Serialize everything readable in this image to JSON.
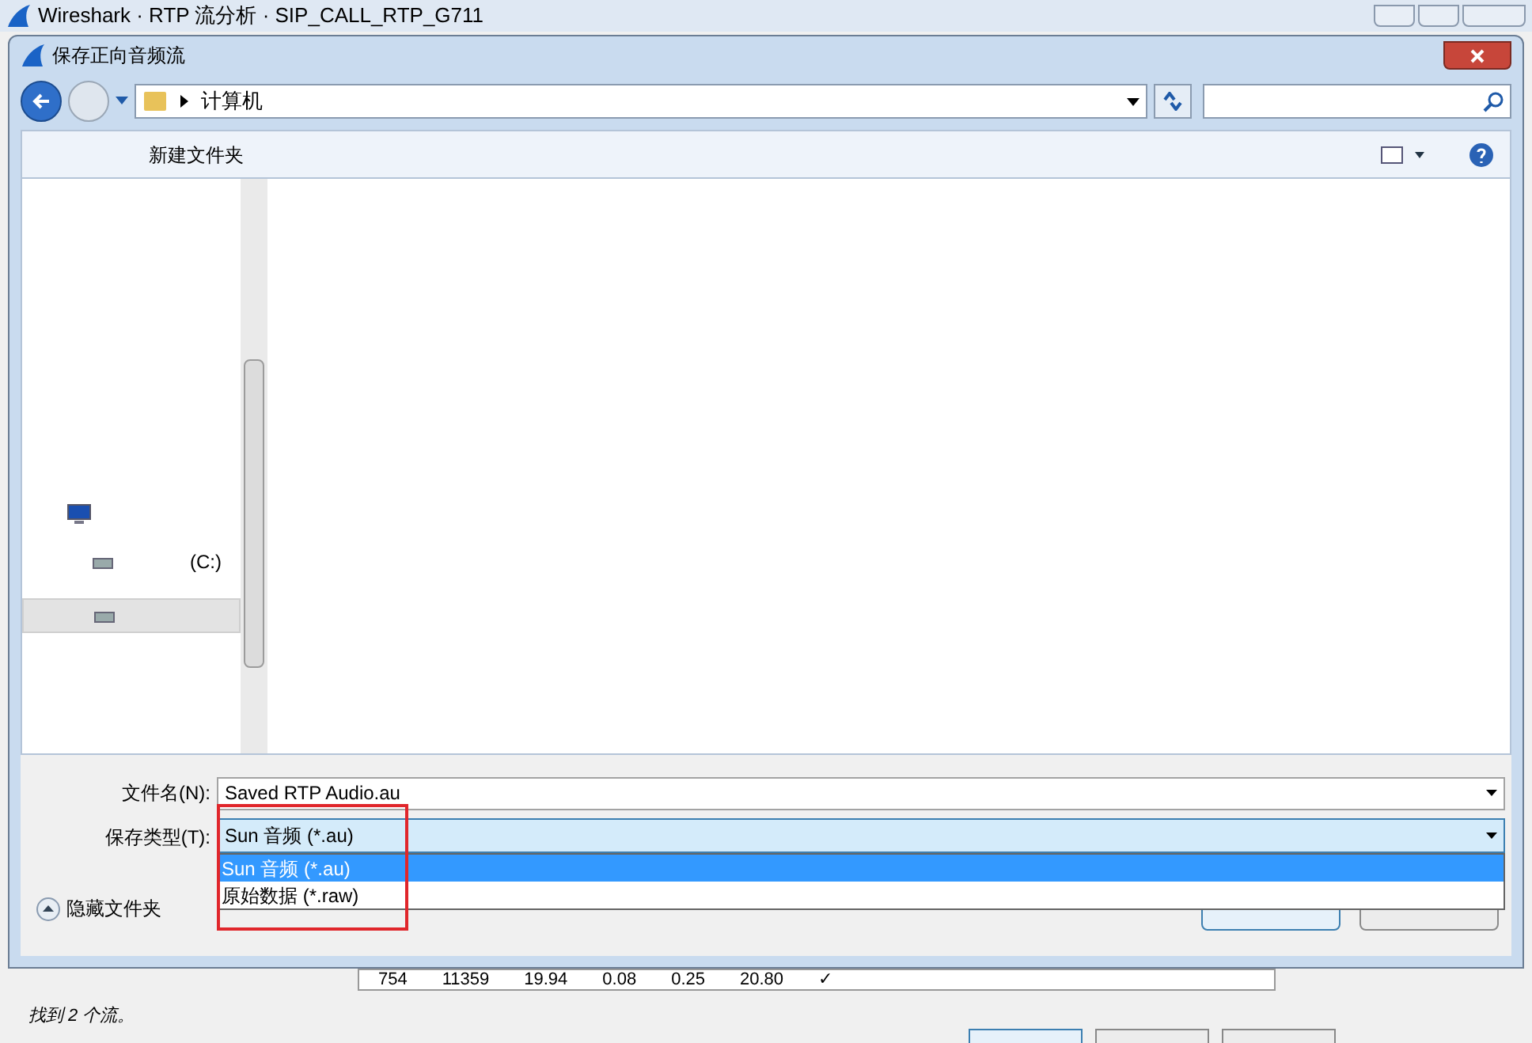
{
  "background_window": {
    "title": "Wireshark · RTP 流分析 · SIP_CALL_RTP_G711",
    "table_row": [
      "754",
      "11359",
      "19.94",
      "0.08",
      "0.25",
      "20.80",
      "✓"
    ],
    "status": "找到 2 个流。"
  },
  "dialog": {
    "title": "保存正向音频流",
    "breadcrumb": [
      "计算机"
    ],
    "toolbar": {
      "new_folder": "新建文件夹"
    },
    "sidebar": {
      "items": [
        {
          "kind": "drive",
          "label": "(C:)",
          "selected": false
        },
        {
          "kind": "drive",
          "selected": true
        }
      ]
    },
    "filename": {
      "label": "文件名(N):",
      "value": "Saved RTP Audio.au"
    },
    "filetype": {
      "label": "保存类型(T):",
      "value": "Sun 音频 (*.au)",
      "expanded": true,
      "options": [
        {
          "label": "Sun 音频 (*.au)",
          "selected": true
        },
        {
          "label": "原始数据 (*.raw)",
          "selected": false
        }
      ]
    },
    "hide_folders": "隐藏文件夹"
  },
  "annotation": {
    "kind": "frame",
    "color": "#e0262b"
  }
}
